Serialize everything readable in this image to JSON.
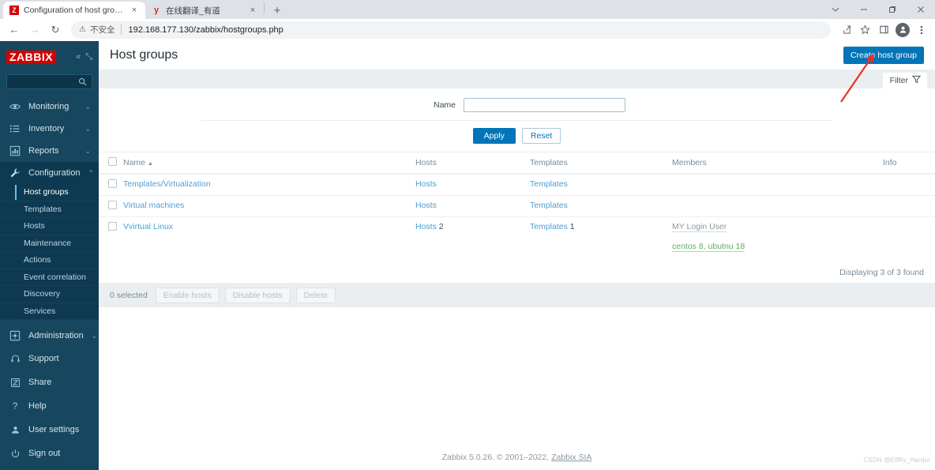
{
  "browser": {
    "tabs": [
      {
        "title": "Configuration of host groups",
        "favicon": "zabbix-icon",
        "favicon_letter": "Z",
        "active": true,
        "close": "×"
      },
      {
        "title": "在线翻译_有道",
        "favicon": "youdao-icon",
        "favicon_letter": "y",
        "active": false,
        "close": "×"
      }
    ],
    "new_tab_label": "+",
    "window_controls": [
      "chevron-down",
      "minimize",
      "maximize",
      "close"
    ],
    "nav": {
      "back": "←",
      "forward": "→",
      "reload": "↻"
    },
    "omnibox": {
      "insecure_label": "不安全",
      "url": "192.168.177.130/zabbix/hostgroups.php",
      "warn_glyph": "⚠"
    },
    "toolbar_icons": [
      "share-icon",
      "bookmark-star-icon",
      "sidepanel-icon",
      "profile-avatar-icon",
      "kebab-menu-icon"
    ]
  },
  "sidebar": {
    "logo": "ZABBIX",
    "collapse_label": "«",
    "hide_label": "⤡",
    "search_placeholder": "",
    "menu": [
      {
        "label": "Monitoring",
        "icon": "eye-icon",
        "arrow": "⌄",
        "expanded": false
      },
      {
        "label": "Inventory",
        "icon": "list-icon",
        "arrow": "⌄",
        "expanded": false
      },
      {
        "label": "Reports",
        "icon": "bar-chart-icon",
        "arrow": "⌄",
        "expanded": false
      },
      {
        "label": "Configuration",
        "icon": "wrench-icon",
        "arrow": "⌃",
        "expanded": true
      },
      {
        "label": "Administration",
        "icon": "gear-icon",
        "arrow": "⌄",
        "expanded": false
      }
    ],
    "configuration_submenu": [
      {
        "label": "Host groups",
        "selected": true
      },
      {
        "label": "Templates",
        "selected": false
      },
      {
        "label": "Hosts",
        "selected": false
      },
      {
        "label": "Maintenance",
        "selected": false
      },
      {
        "label": "Actions",
        "selected": false
      },
      {
        "label": "Event correlation",
        "selected": false
      },
      {
        "label": "Discovery",
        "selected": false
      },
      {
        "label": "Services",
        "selected": false
      }
    ],
    "bottom_items": [
      {
        "label": "Support",
        "icon": "headset-icon"
      },
      {
        "label": "Share",
        "icon": "zabbix-share-icon"
      },
      {
        "label": "Help",
        "icon": "question-icon"
      },
      {
        "label": "User settings",
        "icon": "user-icon"
      },
      {
        "label": "Sign out",
        "icon": "power-icon"
      }
    ]
  },
  "page": {
    "title": "Host groups",
    "create_button": "Create host group"
  },
  "filter": {
    "tab_label": "Filter",
    "tab_icon": "funnel-icon",
    "name_label": "Name",
    "name_value": "",
    "name_placeholder": "",
    "apply_label": "Apply",
    "reset_label": "Reset"
  },
  "table": {
    "columns": {
      "name": "Name",
      "sort_caret": "▲",
      "hosts": "Hosts",
      "templates": "Templates",
      "members": "Members",
      "info": "Info"
    },
    "rows": [
      {
        "name": "Templates/Virtualization",
        "hosts_link": "Hosts",
        "hosts_count": "",
        "templates_link": "Templates",
        "templates_count": "",
        "members_user": "",
        "members_hosts": "",
        "info": ""
      },
      {
        "name": "Virtual machines",
        "hosts_link": "Hosts",
        "hosts_count": "",
        "templates_link": "Templates",
        "templates_count": "",
        "members_user": "",
        "members_hosts": "",
        "info": ""
      },
      {
        "name": "Vvirtual Linux",
        "hosts_link": "Hosts",
        "hosts_count": "2",
        "templates_link": "Templates",
        "templates_count": "1",
        "members_user": "MY Login User",
        "members_hosts": "centos 8, ubutnu 18",
        "info": ""
      }
    ],
    "displaying": "Displaying 3 of 3 found"
  },
  "footer_actions": {
    "selected_count": "0 selected",
    "enable_hosts": "Enable hosts",
    "disable_hosts": "Disable hosts",
    "delete": "Delete"
  },
  "page_footer": {
    "text": "Zabbix 5.0.26. © 2001–2022, ",
    "link": "Zabbix SIA"
  },
  "watermark": "CSDN @ElfRy_Hardur",
  "colors": {
    "brand_red": "#d40000",
    "sidebar_bg": "#16475f",
    "sidebar_submenu_bg": "#0d3a51",
    "accent_blue": "#0275b8",
    "link_blue": "#4d9fd1",
    "member_green": "#59b259",
    "annotation_red": "#e8312a",
    "panel_grey": "#ebeef0"
  }
}
